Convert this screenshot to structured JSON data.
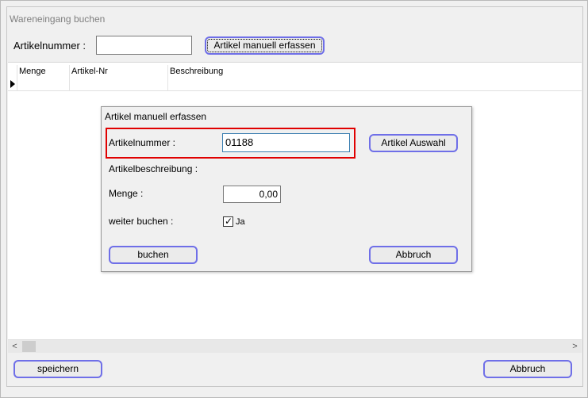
{
  "window": {
    "title": "Wareneingang buchen"
  },
  "top": {
    "artikelnummer_label": "Artikelnummer :",
    "artikelnummer_value": "",
    "manual_button": "Artikel manuell erfassen"
  },
  "grid": {
    "columns": [
      "Menge",
      "Artikel-Nr",
      "Beschreibung"
    ]
  },
  "scrollbar": {
    "left_arrow": "<",
    "right_arrow": ">"
  },
  "footer": {
    "save_button": "speichern",
    "cancel_button": "Abbruch"
  },
  "dialog": {
    "title": "Artikel manuell erfassen",
    "artikelnummer_label": "Artikelnummer :",
    "artikelnummer_value": "01188",
    "auswahl_button": "Artikel Auswahl",
    "beschreibung_label": "Artikelbeschreibung :",
    "menge_label": "Menge :",
    "menge_value": "0,00",
    "weiter_label": "weiter buchen :",
    "weiter_checked": true,
    "weiter_checkbox_label": "Ja",
    "buchen_button": "buchen",
    "abbruch_button": "Abbruch"
  },
  "colors": {
    "button_border": "#6f6fe8",
    "highlight": "#e00000"
  },
  "icons": [
    "row-pointer-icon",
    "checkmark-icon",
    "chevron-left-icon",
    "chevron-right-icon"
  ]
}
